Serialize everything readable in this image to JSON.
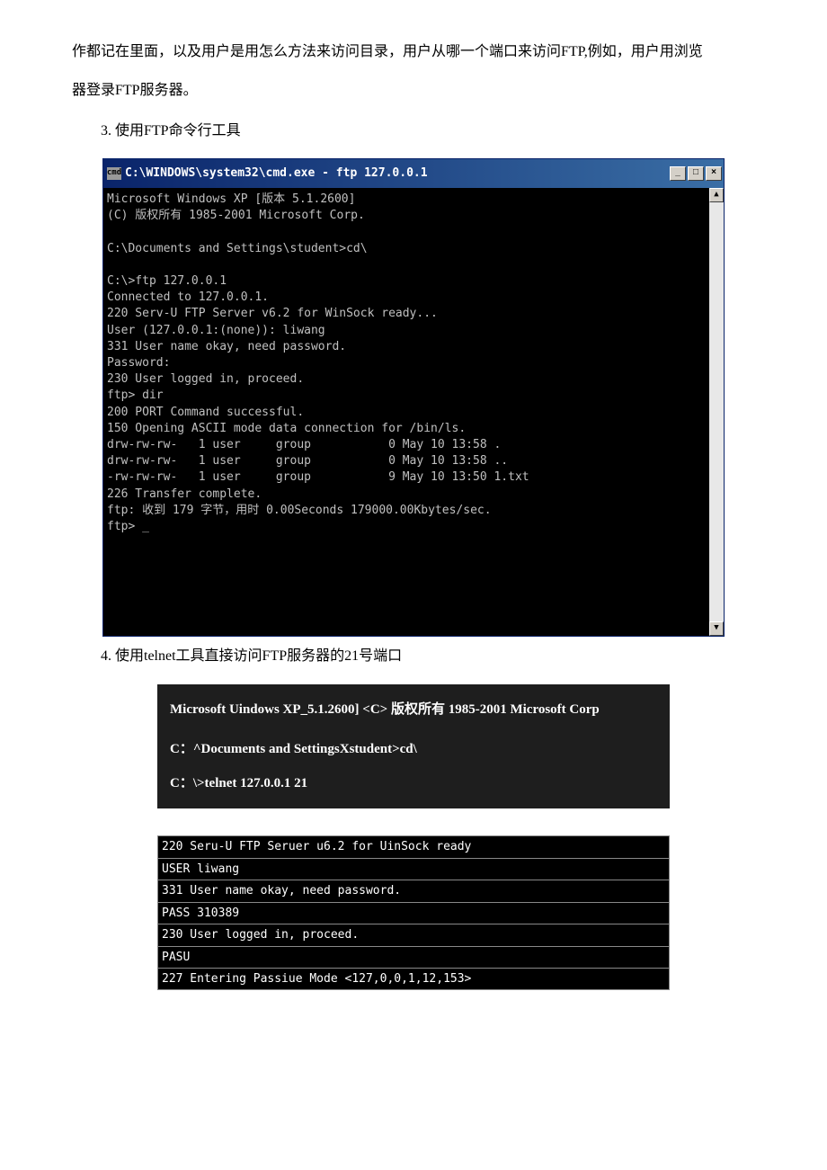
{
  "intro": {
    "line1": "作都记在里面，以及用户是用怎么方法来访问目录，用户从哪一个端口来访问FTP,例如，用户用浏览",
    "line2": "器登录FTP服务器。"
  },
  "heading_3": "3. 使用FTP命令行工具",
  "cmd_window": {
    "icon_text": "cmd",
    "title": "C:\\WINDOWS\\system32\\cmd.exe - ftp 127.0.0.1",
    "btn_min": "_",
    "btn_max": "□",
    "btn_close": "×",
    "scroll_up": "▲",
    "scroll_down": "▼",
    "body": "Microsoft Windows XP [版本 5.1.2600]\n(C) 版权所有 1985-2001 Microsoft Corp.\n\nC:\\Documents and Settings\\student>cd\\\n\nC:\\>ftp 127.0.0.1\nConnected to 127.0.0.1.\n220 Serv-U FTP Server v6.2 for WinSock ready...\nUser (127.0.0.1:(none)): liwang\n331 User name okay, need password.\nPassword:\n230 User logged in, proceed.\nftp> dir\n200 PORT Command successful.\n150 Opening ASCII mode data connection for /bin/ls.\ndrw-rw-rw-   1 user     group           0 May 10 13:58 .\ndrw-rw-rw-   1 user     group           0 May 10 13:58 ..\n-rw-rw-rw-   1 user     group           9 May 10 13:50 1.txt\n226 Transfer complete.\nftp: 收到 179 字节，用时 0.00Seconds 179000.00Kbytes/sec.\nftp> _\n\n\n\n"
  },
  "caption_4": "4. 使用telnet工具直接访问FTP服务器的21号端口",
  "telnet_box1": {
    "l1": "Microsoft Uindows XP_5.1.2600] <C> 版权所有  1985-2001 Microsoft Corp",
    "l2": "C：^Documents and SettingsXstudent>cd\\",
    "l3": "C：\\>telnet 127.0.0.1 21"
  },
  "telnet_box2": {
    "r1": "220 Seru-U FTP Seruer u6.2 for UinSock ready",
    "r2": "USER liwang",
    "r3": "331 User name okay, need password.",
    "r4": "PASS 310389",
    "r5": "230 User logged in, proceed.",
    "r6": "PASU",
    "r7": "227 Entering Passiue Mode <127,0,0,1,12,153>"
  }
}
